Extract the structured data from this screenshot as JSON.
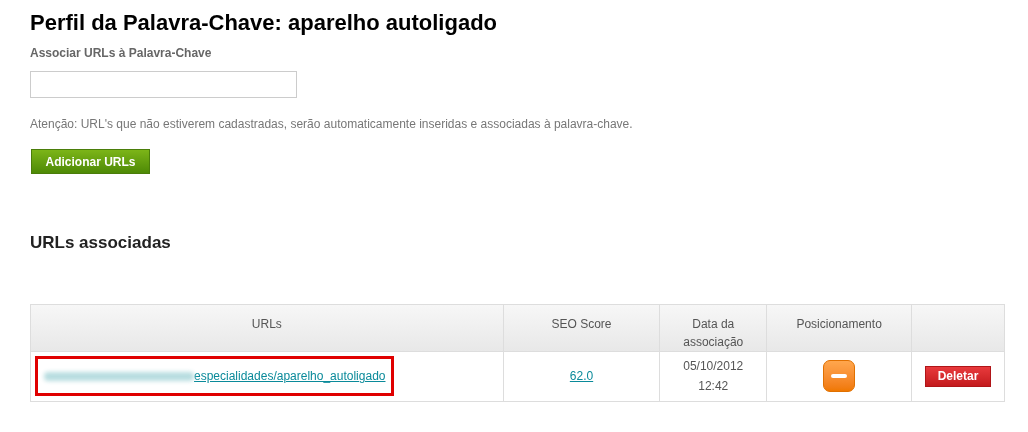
{
  "title": "Perfil da Palavra-Chave: aparelho autoligado",
  "associate_field": {
    "label": "Associar URLs à Palavra-Chave"
  },
  "notice": "Atenção: URL's que não estiverem cadastradas, serão automaticamente inseridas e associadas à palavra-chave.",
  "add_button": "Adicionar URLs",
  "section_title": "URLs associadas",
  "table": {
    "columns": [
      "URLs",
      "SEO Score",
      "Data da associação",
      "Posicionamento",
      ""
    ],
    "rows": [
      {
        "url_visible": "especialidades/aparelho_autoligado",
        "url_redacted": true,
        "highlighted": true,
        "seo_score": "62.0",
        "date": "05/10/2012",
        "time": "12:42",
        "delete_button": "Deletar"
      }
    ]
  }
}
